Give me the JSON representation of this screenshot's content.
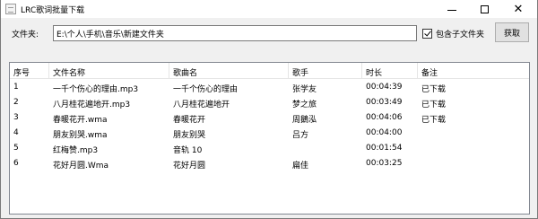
{
  "window": {
    "title": "LRC歌词批量下载",
    "icon": "app-icon"
  },
  "toolbar": {
    "folder_label": "文件夹:",
    "folder_value": "E:\\个人\\手机\\音乐\\新建文件夹",
    "include_subfolders_label": "包含子文件夹",
    "include_subfolders_checked": true,
    "fetch_button": "获取"
  },
  "table": {
    "headers": [
      "序号",
      "文件名称",
      "歌曲名",
      "歌手",
      "时长",
      "备注"
    ],
    "rows": [
      [
        "1",
        "一千个伤心的理由.mp3",
        "一千个伤心的理由",
        "张学友",
        "00:04:39",
        "已下载"
      ],
      [
        "2",
        "八月桂花遍地开.mp3",
        "八月桂花遍地开",
        "梦之旅",
        "00:03:49",
        "已下载"
      ],
      [
        "3",
        "春暖花开.wma",
        "春暖花开",
        "周鵝泓",
        "00:04:06",
        "已下载"
      ],
      [
        "4",
        "朋友别哭.wma",
        "朋友别哭",
        "吕方",
        "00:04:00",
        ""
      ],
      [
        "5",
        "红梅赞.mp3",
        "音轨 10",
        "",
        "00:01:54",
        ""
      ],
      [
        "6",
        "花好月圆.Wma",
        "花好月圆",
        "扁佳",
        "00:03:25",
        ""
      ]
    ]
  }
}
